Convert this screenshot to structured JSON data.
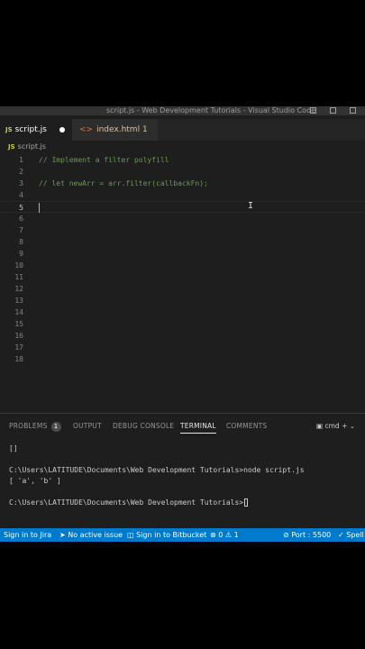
{
  "window": {
    "title": "script.js - Web Development Tutorials - Visual Studio Code"
  },
  "tabs": [
    {
      "badge": "JS",
      "label": "script.js",
      "modified": true
    },
    {
      "badge": "<>",
      "label": "index.html 1"
    }
  ],
  "breadcrumb": {
    "badge": "JS",
    "file": "script.js"
  },
  "editor": {
    "line_numbers": [
      "1",
      "2",
      "3",
      "4",
      "5",
      "6",
      "7",
      "8",
      "9",
      "10",
      "11",
      "12",
      "13",
      "14",
      "15",
      "16",
      "17",
      "18"
    ],
    "lines": [
      "// Implement a filter polyfill",
      "",
      "// let newArr = arr.filter(callbackFn);",
      "",
      "",
      "",
      "",
      "",
      "",
      "",
      "",
      "",
      "",
      "",
      "",
      "",
      "",
      ""
    ],
    "current_line": 5
  },
  "panel": {
    "tabs": [
      {
        "label": "PROBLEMS",
        "badge": "1"
      },
      {
        "label": "OUTPUT"
      },
      {
        "label": "DEBUG CONSOLE"
      },
      {
        "label": "TERMINAL",
        "active": true
      },
      {
        "label": "COMMENTS"
      }
    ],
    "terminal_shell": "cmd",
    "terminal_lines": [
      "[]",
      "",
      "C:\\Users\\LATITUDE\\Documents\\Web Development Tutorials>node script.js",
      "[ 'a', 'b' ]",
      "",
      "C:\\Users\\LATITUDE\\Documents\\Web Development Tutorials>"
    ]
  },
  "statusbar": {
    "jira": "Sign in to Jira",
    "issue": "No active issue",
    "bitbucket": "Sign in to Bitbucket",
    "errors": "0",
    "warnings": "1",
    "port": "Port : 5500",
    "spell": "Spell"
  },
  "colors": {
    "statusbar": "#007acc",
    "comment": "#6a9955",
    "editor_bg": "#1e1e1e"
  }
}
